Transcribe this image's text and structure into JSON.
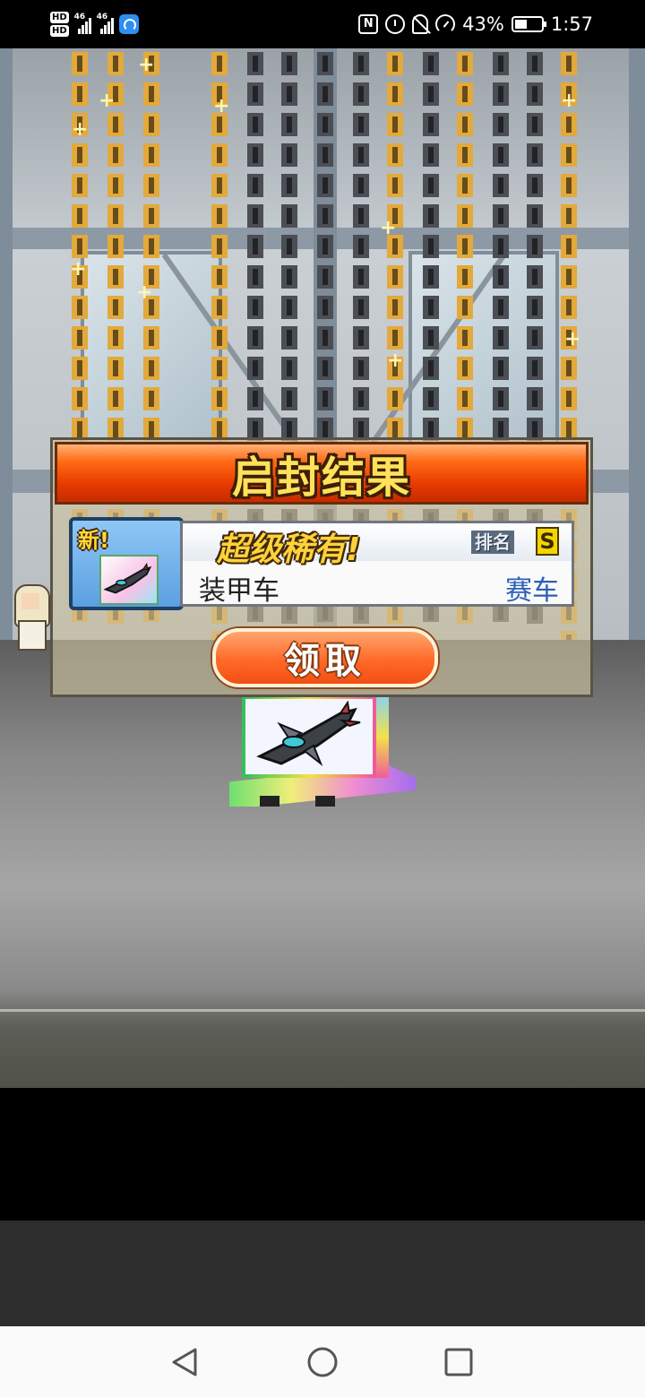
{
  "status_bar": {
    "hd1": "HD",
    "hd2": "HD",
    "net1": "46",
    "net2": "46",
    "battery": "43%",
    "time": "1:57"
  },
  "dialog": {
    "title": "启封结果",
    "new_tag": "新!",
    "rarity": "超级稀有!",
    "rank_label": "排名",
    "rank_value": "S",
    "item_name": "装甲车",
    "item_category": "赛车",
    "claim_label": "领取"
  },
  "colors": {
    "title_bar": "#e63a00",
    "title_text": "#ffe15a",
    "button": "#ff6a28",
    "category_text": "#2c5fb8"
  },
  "icons": [
    "nfc-icon",
    "alarm-icon",
    "mute-bell-icon",
    "speed-icon",
    "battery-icon",
    "back-icon",
    "home-icon",
    "recent-apps-icon"
  ]
}
